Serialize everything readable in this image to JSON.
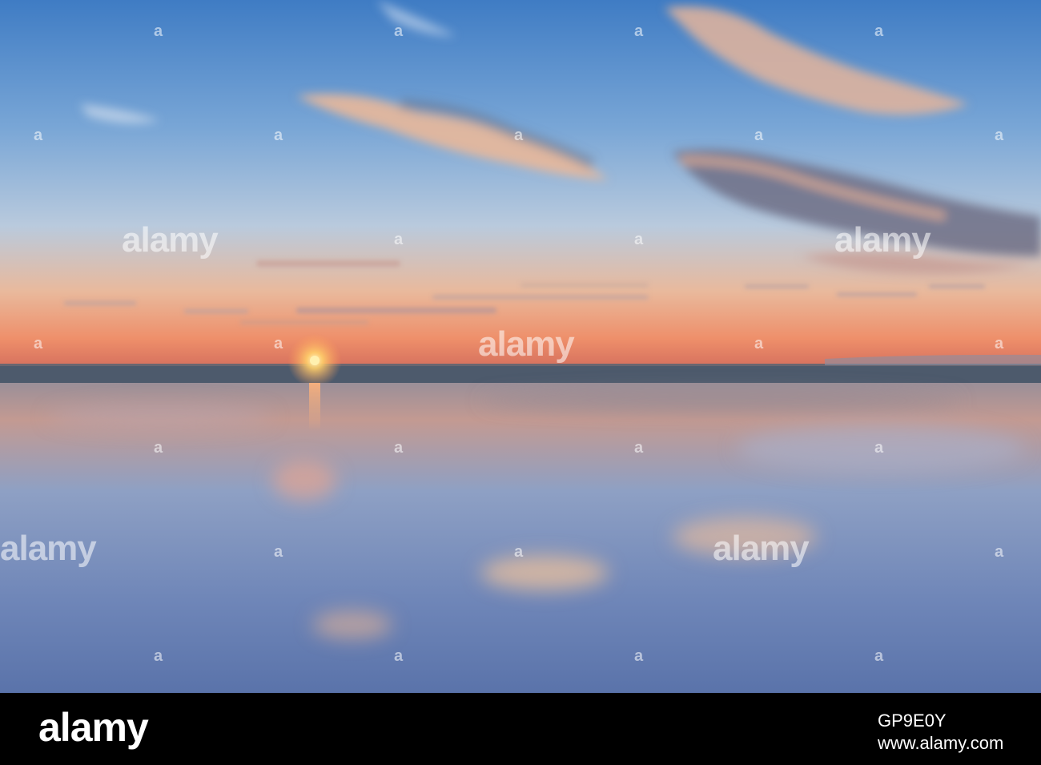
{
  "photo": {
    "description_colors": {
      "sky_top": "#4f87c7",
      "sky_mid": "#8fb2d6",
      "sky_horizon": "#f09a6e",
      "sun": "#ffd36a",
      "sea": "#3f5063",
      "sand_wet": "#6e88b4",
      "sand_reflection": "#f1b08a"
    }
  },
  "watermark": {
    "text": "alamy",
    "small_text": "a"
  },
  "footer": {
    "logo": "alamy",
    "image_id": "GP9E0Y",
    "site": "www.alamy.com"
  }
}
